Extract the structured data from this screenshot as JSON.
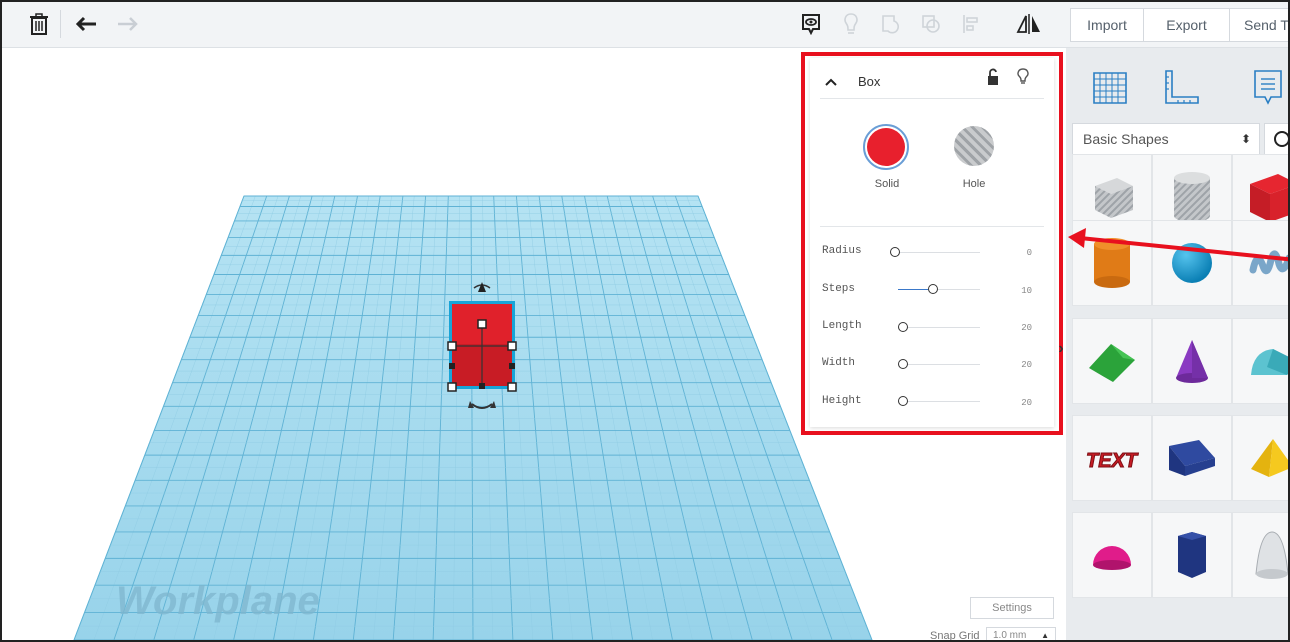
{
  "toolbar": {
    "import_label": "Import",
    "export_label": "Export",
    "send_to_label": "Send To"
  },
  "workplane": {
    "watermark": "Workplane"
  },
  "inspector": {
    "title": "Box",
    "solid_label": "Solid",
    "hole_label": "Hole",
    "solid_color": "#e8202d",
    "properties": [
      {
        "label": "Radius",
        "value": "0"
      },
      {
        "label": "Steps",
        "value": "10"
      },
      {
        "label": "Length",
        "value": "20"
      },
      {
        "label": "Width",
        "value": "20"
      },
      {
        "label": "Height",
        "value": "20"
      }
    ]
  },
  "settings_label": "Settings",
  "snap_grid": {
    "label": "Snap Grid",
    "value": "1.0 mm"
  },
  "shapes_panel": {
    "category": "Basic Shapes",
    "tiles": [
      "box-hole",
      "cylinder-hole",
      "box",
      "cylinder",
      "sphere",
      "scribble",
      "roof",
      "cone",
      "round-roof",
      "text",
      "wedge",
      "pyramid",
      "half-sphere",
      "polygon",
      "paraboloid"
    ],
    "text_tile_label": "TEXT"
  },
  "colors": {
    "highlight": "#e8101e",
    "grid": "#a9dcef",
    "box_red": "#d8232a"
  }
}
